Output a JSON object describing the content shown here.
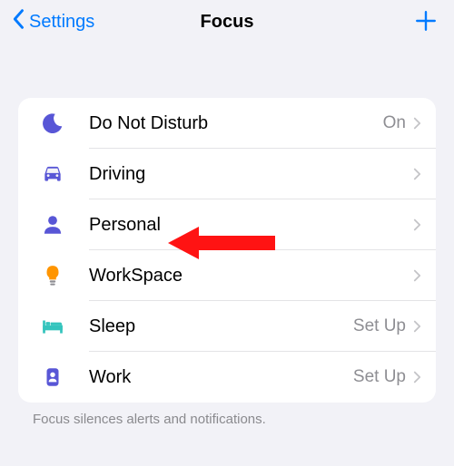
{
  "nav": {
    "back_label": "Settings",
    "title": "Focus"
  },
  "rows": [
    {
      "label": "Do Not Disturb",
      "status": "On"
    },
    {
      "label": "Driving",
      "status": ""
    },
    {
      "label": "Personal",
      "status": ""
    },
    {
      "label": "WorkSpace",
      "status": ""
    },
    {
      "label": "Sleep",
      "status": "Set Up"
    },
    {
      "label": "Work",
      "status": "Set Up"
    }
  ],
  "footer": "Focus silences alerts and notifications.",
  "colors": {
    "accent": "#007aff",
    "purple": "#5856d6",
    "orange": "#ff9500",
    "teal": "#34c4bd",
    "gray_text": "#8e8e93"
  }
}
